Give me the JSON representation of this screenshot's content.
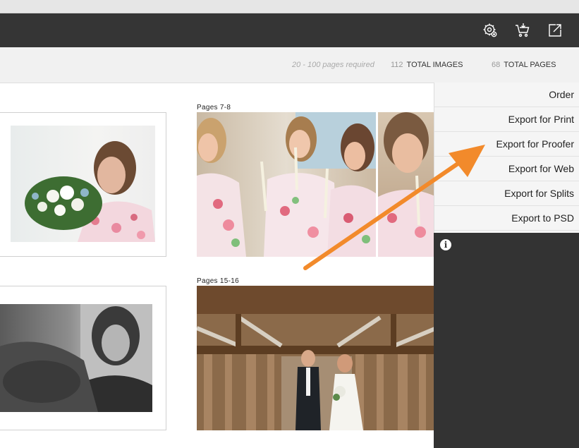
{
  "toolbar": {
    "icons": [
      "settings-gear-icon",
      "cart-icon",
      "share-export-icon"
    ]
  },
  "stats": {
    "requirement": "20 - 100 pages required",
    "images_count": "112",
    "images_label": "TOTAL IMAGES",
    "pages_count": "68",
    "pages_label": "TOTAL PAGES"
  },
  "spreads": [
    {
      "label": ""
    },
    {
      "label": "Pages 7-8"
    },
    {
      "label": ""
    },
    {
      "label": "Pages 15-16"
    }
  ],
  "menu": {
    "items": [
      "Order",
      "Export for Print",
      "Export for Proofer",
      "Export for Web",
      "Export for Splits",
      "Export to PSD"
    ]
  },
  "panel": {
    "info_icon": "i"
  },
  "colors": {
    "toolbar_bg": "#353535",
    "panel_bg": "#333333",
    "arrow": "#f28a2b"
  }
}
